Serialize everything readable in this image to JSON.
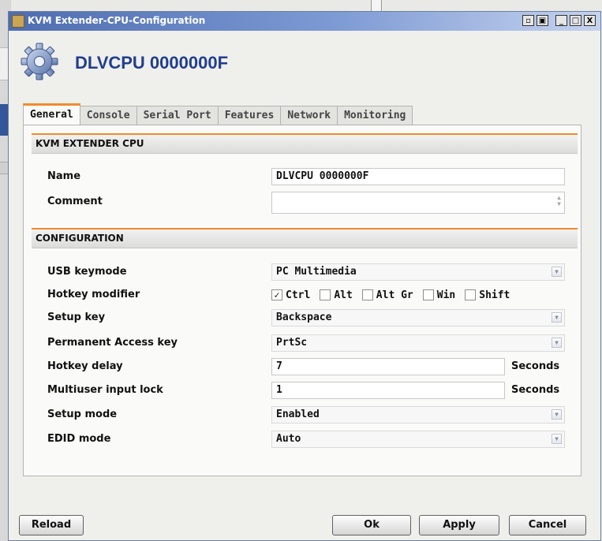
{
  "window": {
    "title": "KVM Extender-CPU-Configuration",
    "buttons": {
      "restore": "▫",
      "float": "▣",
      "minimize": "_",
      "maximize": "□",
      "close": "X"
    }
  },
  "header": {
    "title": "DLVCPU 0000000F",
    "icon": "gear-icon"
  },
  "tabs": [
    "General",
    "Console",
    "Serial Port",
    "Features",
    "Network",
    "Monitoring"
  ],
  "active_tab": "General",
  "sections": {
    "cpu": "KVM EXTENDER CPU",
    "config": "CONFIGURATION"
  },
  "fields": {
    "name": {
      "label": "Name",
      "value": "DLVCPU 0000000F"
    },
    "comment": {
      "label": "Comment",
      "value": ""
    },
    "usb_keymode": {
      "label": "USB keymode",
      "value": "PC Multimedia"
    },
    "hotkey_modifier": {
      "label": "Hotkey modifier",
      "options": [
        {
          "label": "Ctrl",
          "checked": "✓"
        },
        {
          "label": "Alt",
          "checked": ""
        },
        {
          "label": "Alt Gr",
          "checked": ""
        },
        {
          "label": "Win",
          "checked": ""
        },
        {
          "label": "Shift",
          "checked": ""
        }
      ]
    },
    "setup_key": {
      "label": "Setup key",
      "value": "Backspace"
    },
    "permanent_access_key": {
      "label": "Permanent Access key",
      "value": "PrtSc"
    },
    "hotkey_delay": {
      "label": "Hotkey delay",
      "value": "7",
      "unit": "Seconds"
    },
    "multiuser_input_lock": {
      "label": "Multiuser input lock",
      "value": "1",
      "unit": "Seconds"
    },
    "setup_mode": {
      "label": "Setup mode",
      "value": "Enabled"
    },
    "edid_mode": {
      "label": "EDID mode",
      "value": "Auto"
    }
  },
  "footer": {
    "reload": "Reload",
    "ok": "Ok",
    "apply": "Apply",
    "cancel": "Cancel"
  }
}
